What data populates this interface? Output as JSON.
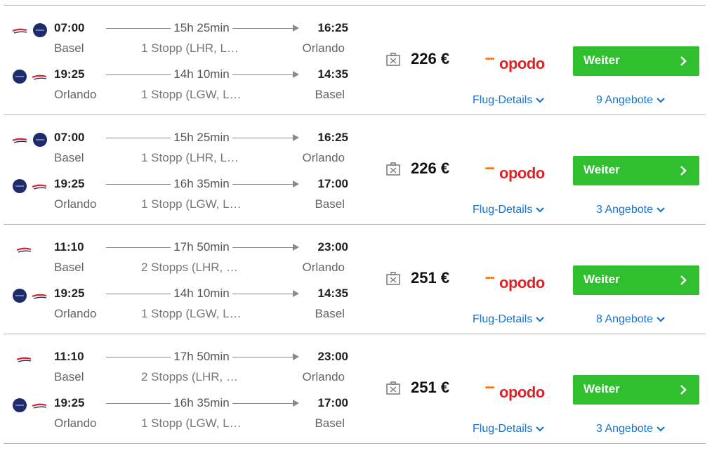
{
  "colors": {
    "accent_button": "#2fbf2f",
    "link": "#1a73c9",
    "provider_red": "#d6262a",
    "provider_orange": "#ff6a00",
    "airline_navy": "#1d2a6b",
    "airline_red": "#e2202c"
  },
  "icons": {
    "airline_a": "british-airways-speedmarque",
    "airline_b": "navy-roundel-logo",
    "bag": "baggage-icon",
    "chevron": "chevron-right-icon",
    "dropdown": "chevron-down-icon"
  },
  "results": [
    {
      "outbound": {
        "logos": [
          "ba",
          "navy"
        ],
        "dep_time": "07:00",
        "duration": "15h 25min",
        "arr_time": "16:25",
        "dep_city": "Basel",
        "stops": "1 Stopp (LHR, L…",
        "arr_city": "Orlando"
      },
      "return": {
        "logos": [
          "navy",
          "ba"
        ],
        "dep_time": "19:25",
        "duration": "14h 10min",
        "arr_time": "14:35",
        "dep_city": "Orlando",
        "stops": "1 Stopp (LGW, L…",
        "arr_city": "Basel"
      },
      "price": "226 €",
      "provider": "opodo",
      "button": "Weiter",
      "details_link": "Flug-Details",
      "offers_link": "9 Angebote"
    },
    {
      "outbound": {
        "logos": [
          "ba",
          "navy"
        ],
        "dep_time": "07:00",
        "duration": "15h 25min",
        "arr_time": "16:25",
        "dep_city": "Basel",
        "stops": "1 Stopp (LHR, L…",
        "arr_city": "Orlando"
      },
      "return": {
        "logos": [
          "navy",
          "ba"
        ],
        "dep_time": "19:25",
        "duration": "16h 35min",
        "arr_time": "17:00",
        "dep_city": "Orlando",
        "stops": "1 Stopp (LGW, L…",
        "arr_city": "Basel"
      },
      "price": "226 €",
      "provider": "opodo",
      "button": "Weiter",
      "details_link": "Flug-Details",
      "offers_link": "3 Angebote"
    },
    {
      "outbound": {
        "logos": [
          "ba"
        ],
        "dep_time": "11:10",
        "duration": "17h 50min",
        "arr_time": "23:00",
        "dep_city": "Basel",
        "stops": "2 Stopps (LHR, …",
        "arr_city": "Orlando"
      },
      "return": {
        "logos": [
          "navy",
          "ba"
        ],
        "dep_time": "19:25",
        "duration": "14h 10min",
        "arr_time": "14:35",
        "dep_city": "Orlando",
        "stops": "1 Stopp (LGW, L…",
        "arr_city": "Basel"
      },
      "price": "251 €",
      "provider": "opodo",
      "button": "Weiter",
      "details_link": "Flug-Details",
      "offers_link": "8 Angebote"
    },
    {
      "outbound": {
        "logos": [
          "ba"
        ],
        "dep_time": "11:10",
        "duration": "17h 50min",
        "arr_time": "23:00",
        "dep_city": "Basel",
        "stops": "2 Stopps (LHR, …",
        "arr_city": "Orlando"
      },
      "return": {
        "logos": [
          "navy",
          "ba"
        ],
        "dep_time": "19:25",
        "duration": "16h 35min",
        "arr_time": "17:00",
        "dep_city": "Orlando",
        "stops": "1 Stopp (LGW, L…",
        "arr_city": "Basel"
      },
      "price": "251 €",
      "provider": "opodo",
      "button": "Weiter",
      "details_link": "Flug-Details",
      "offers_link": "3 Angebote"
    }
  ]
}
